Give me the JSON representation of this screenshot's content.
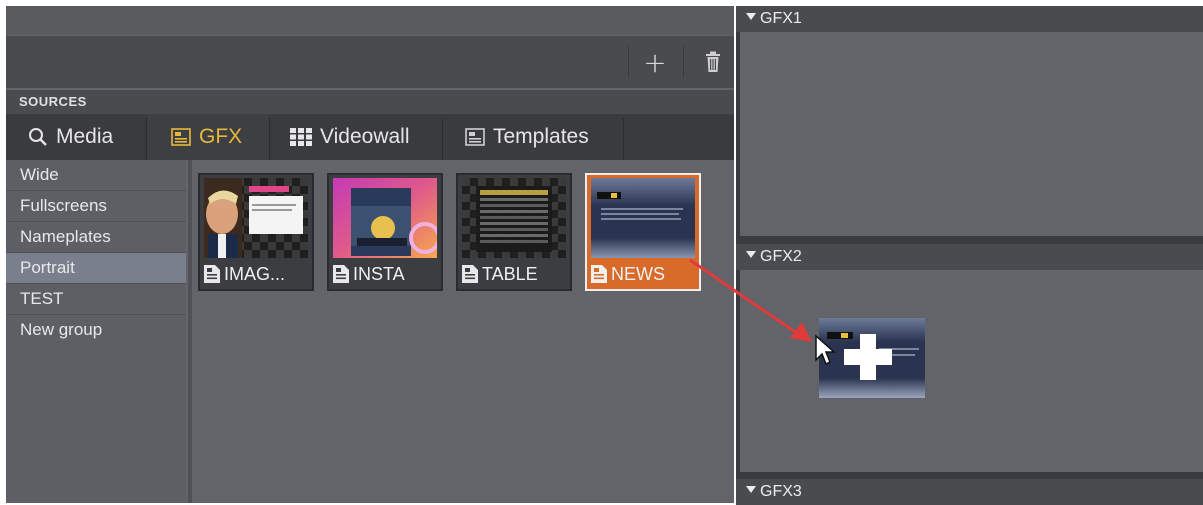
{
  "toolbar": {
    "add_label": "+",
    "delete_icon": "trash-icon"
  },
  "sources": {
    "label": "SOURCES",
    "tabs": [
      {
        "label": "Media",
        "icon": "search-icon"
      },
      {
        "label": "GFX",
        "icon": "gfx-icon",
        "active": true
      },
      {
        "label": "Videowall",
        "icon": "videowall-grid-icon"
      },
      {
        "label": "Templates",
        "icon": "template-icon"
      }
    ],
    "groups": [
      {
        "label": "Wide"
      },
      {
        "label": "Fullscreens"
      },
      {
        "label": "Nameplates"
      },
      {
        "label": "Portrait",
        "selected": true
      },
      {
        "label": "TEST"
      },
      {
        "label": "New group"
      }
    ],
    "items": [
      {
        "label": "IMAG..."
      },
      {
        "label": "INSTA"
      },
      {
        "label": "TABLE"
      },
      {
        "label": "NEWS",
        "selected": true
      }
    ]
  },
  "gfx_layers": [
    {
      "label": "GFX1"
    },
    {
      "label": "GFX2"
    },
    {
      "label": "GFX3"
    }
  ],
  "colors": {
    "accent": "#e8b83a",
    "selected_tile": "#d86b2a",
    "drag_arrow": "#e03a3a",
    "panel_bg": "#636469"
  }
}
